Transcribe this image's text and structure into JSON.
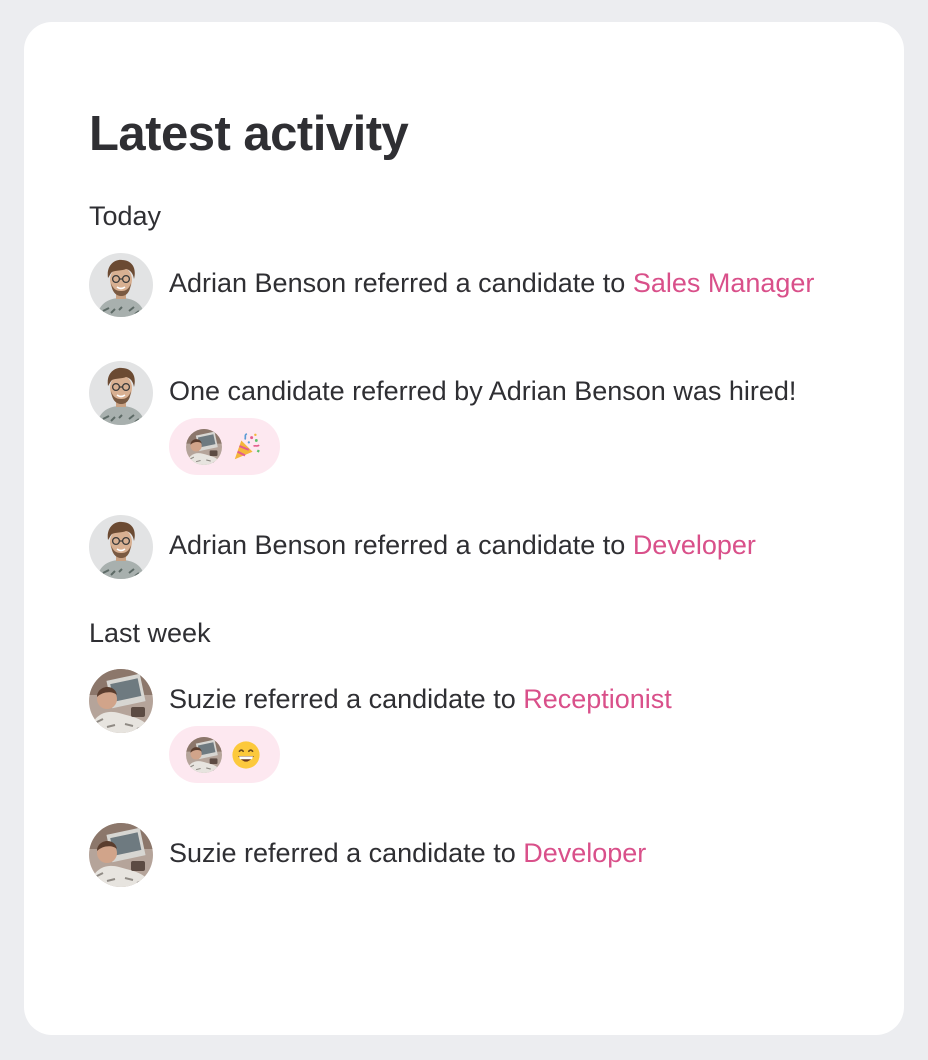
{
  "title": "Latest activity",
  "sections": [
    {
      "label": "Today",
      "items": [
        {
          "prefix": "Adrian Benson referred a candidate to ",
          "link": "Sales Manager",
          "avatar": "adrian-avatar"
        },
        {
          "prefix": "One candidate referred by Adrian Benson was hired!",
          "link": "",
          "avatar": "adrian-avatar",
          "reaction": "party-popper-emoji"
        },
        {
          "prefix": "Adrian Benson referred a candidate to ",
          "link": "Developer",
          "avatar": "adrian-avatar"
        }
      ]
    },
    {
      "label": "Last week",
      "items": [
        {
          "prefix": "Suzie referred a candidate to ",
          "link": "Receptionist",
          "avatar": "suzie-avatar",
          "reaction": "grinning-face-emoji"
        },
        {
          "prefix": "Suzie referred a candidate to ",
          "link": "Developer",
          "avatar": "suzie-avatar"
        }
      ]
    }
  ],
  "colors": {
    "accent": "#d9508a",
    "reaction_bg": "#fde8f0",
    "text": "#2f2f33",
    "page_bg": "#ecedf0"
  }
}
